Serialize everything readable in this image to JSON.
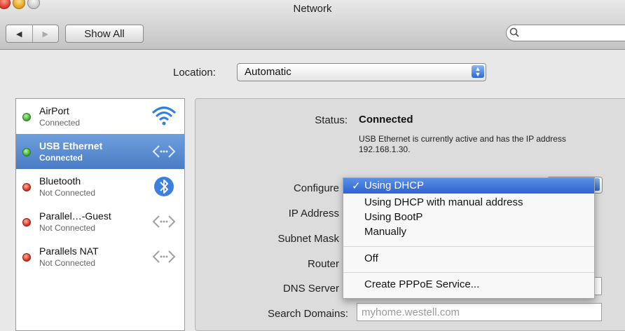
{
  "window": {
    "title": "Network",
    "controls": [
      "close",
      "minimize",
      "zoom"
    ]
  },
  "toolbar": {
    "back_glyph": "◀",
    "forward_glyph": "▶",
    "show_all_label": "Show All",
    "search_placeholder": ""
  },
  "location": {
    "label": "Location:",
    "value": "Automatic"
  },
  "services": [
    {
      "name": "AirPort",
      "status": "Connected",
      "status_color": "green",
      "icon": "wifi-icon",
      "selected": false
    },
    {
      "name": "USB Ethernet",
      "status": "Connected",
      "status_color": "green",
      "icon": "ethernet-icon",
      "selected": true
    },
    {
      "name": "Bluetooth",
      "status": "Not Connected",
      "status_color": "red",
      "icon": "bluetooth-icon",
      "selected": false
    },
    {
      "name": "Parallel…-Guest",
      "status": "Not Connected",
      "status_color": "red",
      "icon": "ethernet-icon",
      "selected": false
    },
    {
      "name": "Parallels NAT",
      "status": "Not Connected",
      "status_color": "red",
      "icon": "ethernet-icon",
      "selected": false
    }
  ],
  "details": {
    "status_label": "Status:",
    "status_value": "Connected",
    "status_description": "USB Ethernet is currently active and has the IP address 192.168.1.30.",
    "configure_label": "Configure",
    "ip_label": "IP Address",
    "subnet_label": "Subnet Mask",
    "router_label": "Router",
    "dns_label": "DNS Server",
    "search_domains_label": "Search Domains:",
    "search_domains_value": "myhome.westell.com"
  },
  "configure_menu": {
    "checkmark": "✓",
    "selected": "Using DHCP",
    "items": [
      "Using DHCP",
      "Using DHCP with manual address",
      "Using BootP",
      "Manually",
      "Off",
      "Create PPPoE Service..."
    ]
  },
  "colors": {
    "selection": "#4a7cc6",
    "menu_highlight": "#2f62cf",
    "connected": "#3aa82a",
    "not_connected": "#d42a1a"
  }
}
